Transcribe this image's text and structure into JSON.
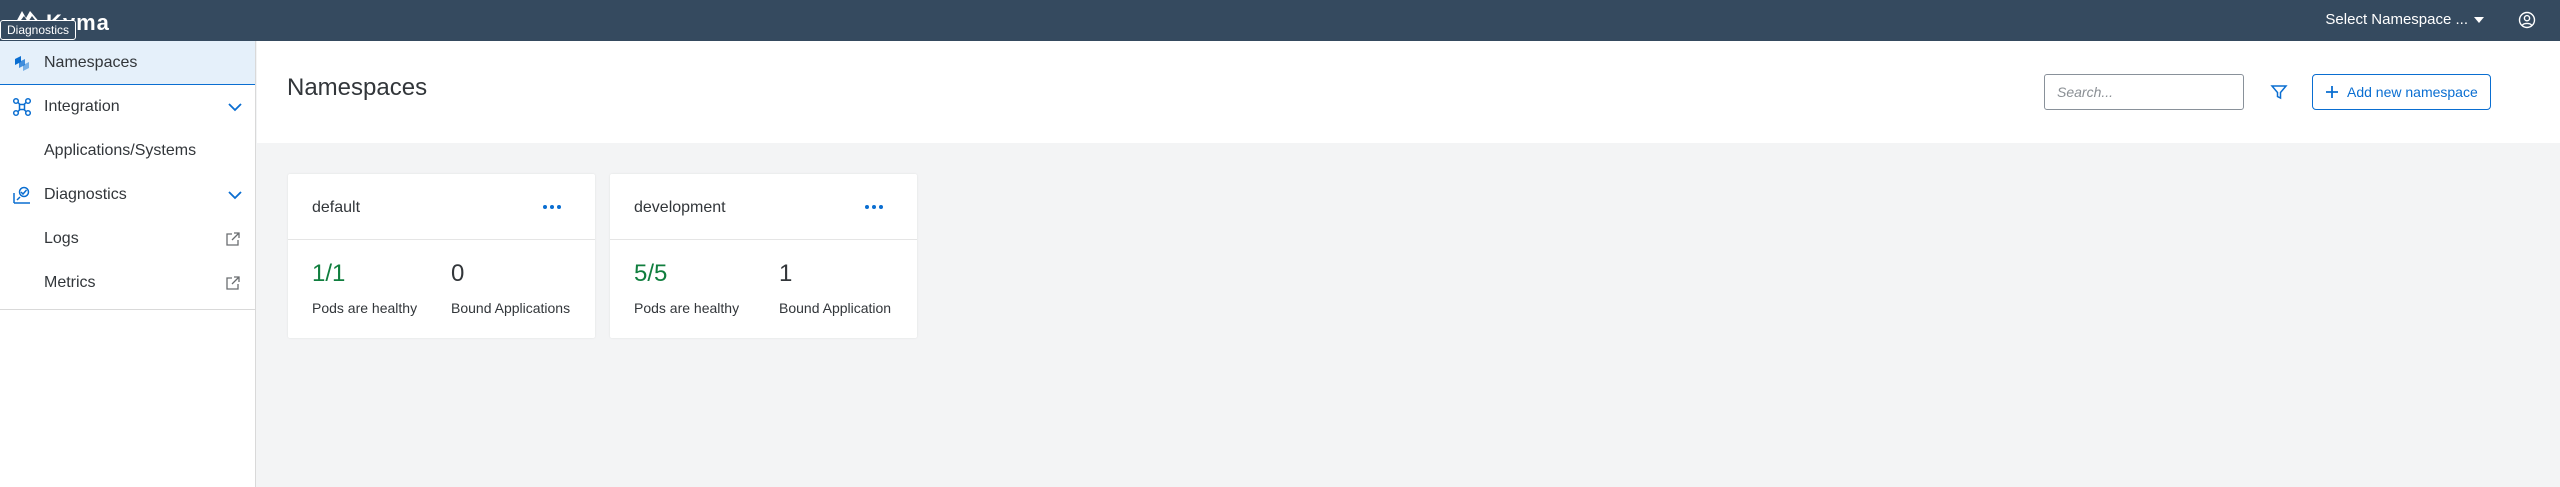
{
  "shell": {
    "brand_name": "Kyma",
    "tooltip": "Diagnostics",
    "namespace_select": "Select Namespace ..."
  },
  "sidebar": {
    "items": [
      {
        "label": "Namespaces",
        "icon": "namespaces-icon",
        "active": true
      },
      {
        "label": "Integration",
        "icon": "integration-icon",
        "expanded": true
      },
      {
        "label": "Applications/Systems"
      },
      {
        "label": "Diagnostics",
        "icon": "diagnostics-icon",
        "expanded": true
      },
      {
        "label": "Logs",
        "external": true
      },
      {
        "label": "Metrics",
        "external": true
      }
    ]
  },
  "header": {
    "title": "Namespaces",
    "search_placeholder": "Search...",
    "add_button": "Add new namespace"
  },
  "cards": [
    {
      "name": "default",
      "pods_value": "1/1",
      "pods_label": "Pods are healthy",
      "apps_value": "0",
      "apps_label": "Bound Applications"
    },
    {
      "name": "development",
      "pods_value": "5/5",
      "pods_label": "Pods are healthy",
      "apps_value": "1",
      "apps_label": "Bound Application"
    }
  ],
  "colors": {
    "shell_bg": "#354a5f",
    "accent": "#0a6ed1",
    "healthy": "#107e3e",
    "page_bg": "#f3f4f5"
  }
}
